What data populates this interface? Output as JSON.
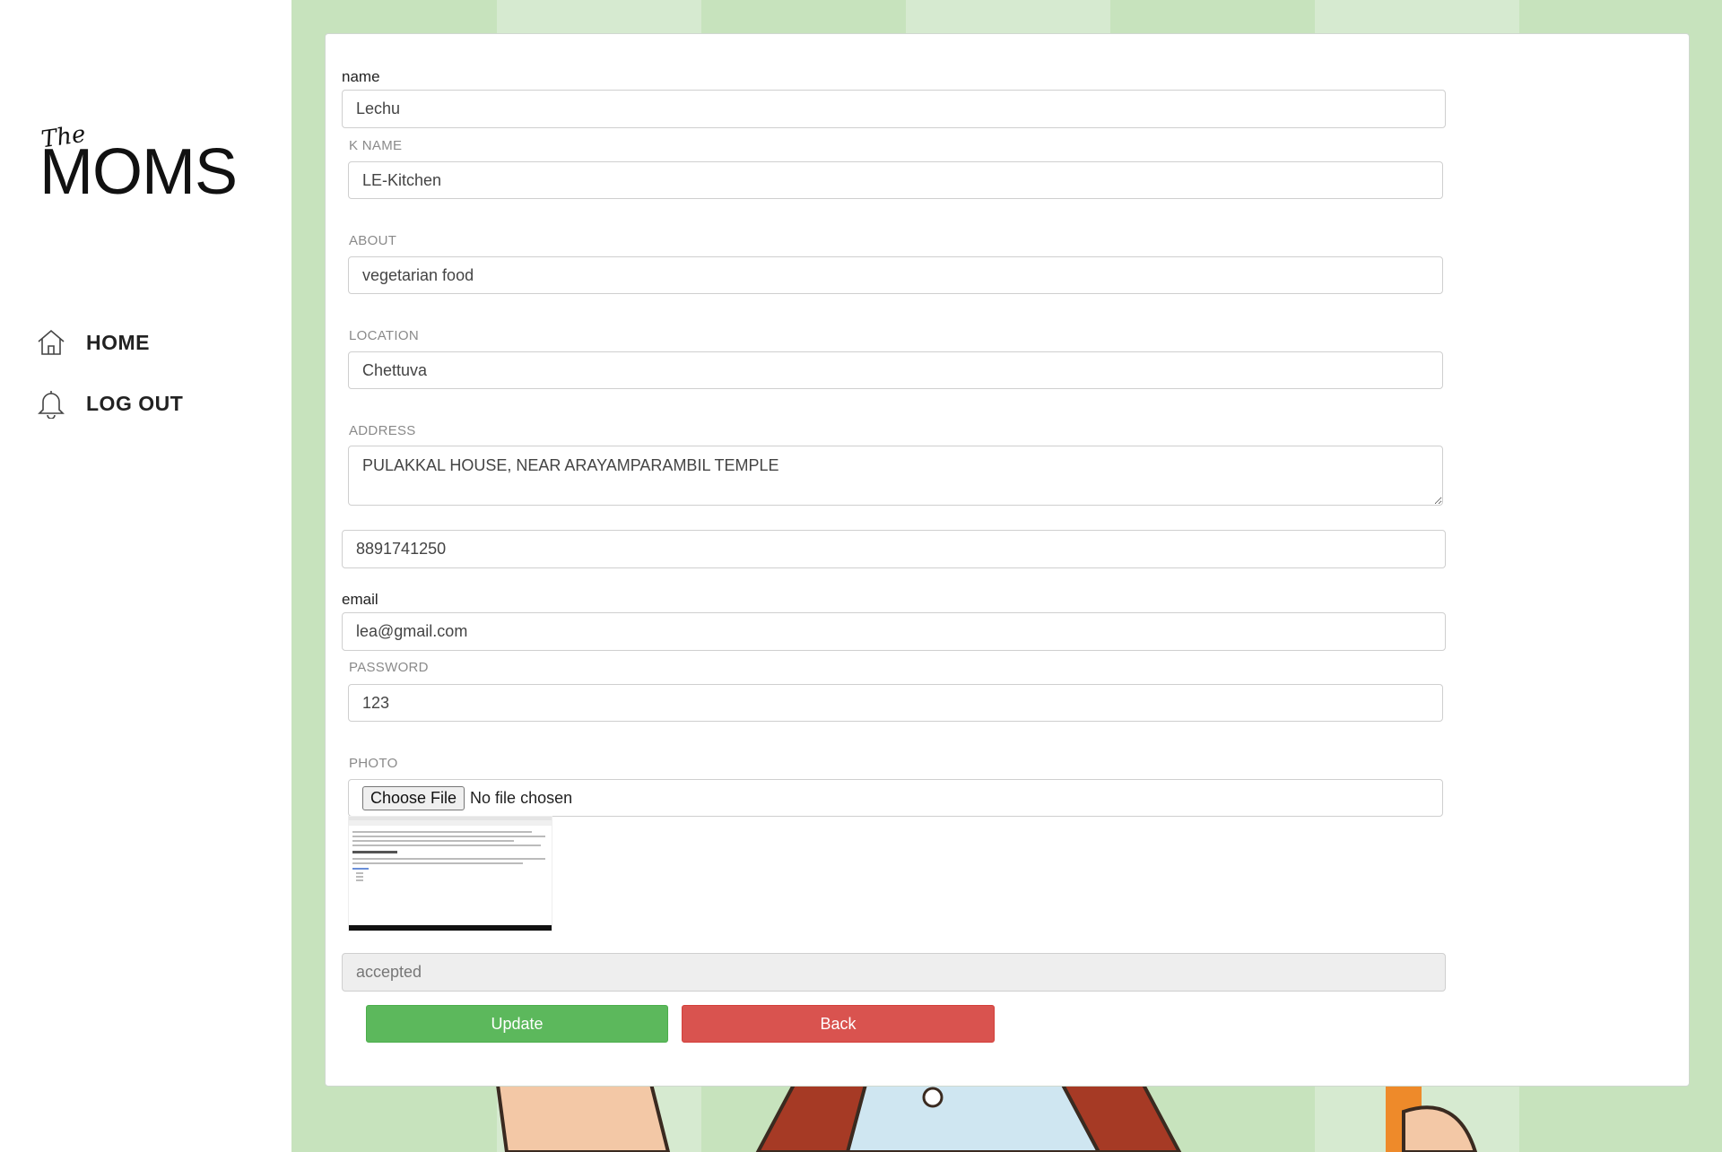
{
  "brand": {
    "logo_small": "The",
    "logo_main": "MOMS"
  },
  "nav": [
    {
      "label": "HOME",
      "icon": "home-icon"
    },
    {
      "label": "LOG OUT",
      "icon": "bell-icon"
    }
  ],
  "form": {
    "name": {
      "label": "name",
      "value": "Lechu"
    },
    "kitchen_name": {
      "label": "K NAME",
      "value": "LE-Kitchen"
    },
    "about": {
      "label": "ABOUT",
      "value": "vegetarian food"
    },
    "location": {
      "label": "LOCATION",
      "value": "Chettuva"
    },
    "address": {
      "label": "ADDRESS",
      "value": "PULAKKAL HOUSE, NEAR ARAYAMPARAMBIL TEMPLE"
    },
    "phone": {
      "value": "8891741250"
    },
    "email": {
      "label": "email",
      "value": "lea@gmail.com"
    },
    "password": {
      "label": "PASSWORD",
      "value": "123"
    },
    "photo": {
      "label": "PHOTO",
      "button": "Choose File",
      "status": "No file chosen"
    },
    "status": {
      "value": "accepted"
    },
    "update_label": "Update",
    "back_label": "Back"
  },
  "colors": {
    "background": "#c7e3bd",
    "update": "#5cb85c",
    "back": "#d9534f"
  }
}
